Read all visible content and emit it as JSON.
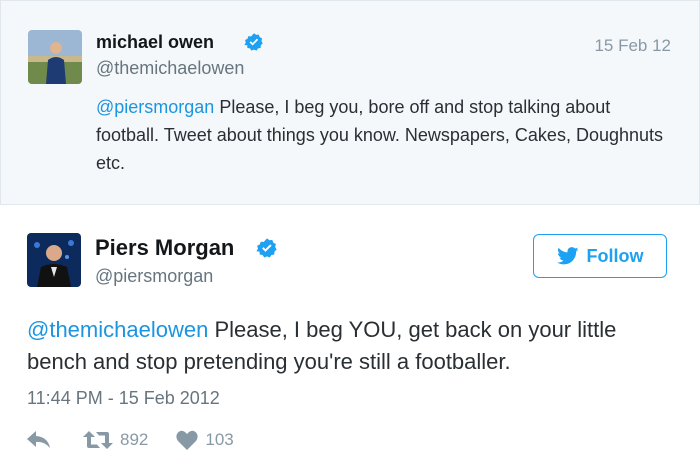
{
  "parent_tweet": {
    "name": "michael owen",
    "handle": "@themichaelowen",
    "date": "15 Feb 12",
    "mention": "@piersmorgan",
    "text": " Please, I beg you, bore off and stop talking about football. Tweet about things you know. Newspapers, Cakes, Doughnuts etc.",
    "avatar_icon": "person-photo-icon",
    "verified_icon": "verified-badge-icon"
  },
  "main_tweet": {
    "name": "Piers Morgan",
    "handle": "@piersmorgan",
    "follow_label": "Follow",
    "mention": "@themichaelowen",
    "text": " Please, I beg YOU, get back on your little bench and stop pretending you're still a footballer.",
    "timestamp": "11:44 PM - 15 Feb 2012",
    "retweet_count": "892",
    "like_count": "103",
    "avatar_icon": "person-photo-icon",
    "verified_icon": "verified-badge-icon"
  },
  "colors": {
    "accent": "#1da1f2",
    "mention": "#1b95e0",
    "muted": "#8899a6",
    "parent_bg": "#f5f8fa"
  }
}
